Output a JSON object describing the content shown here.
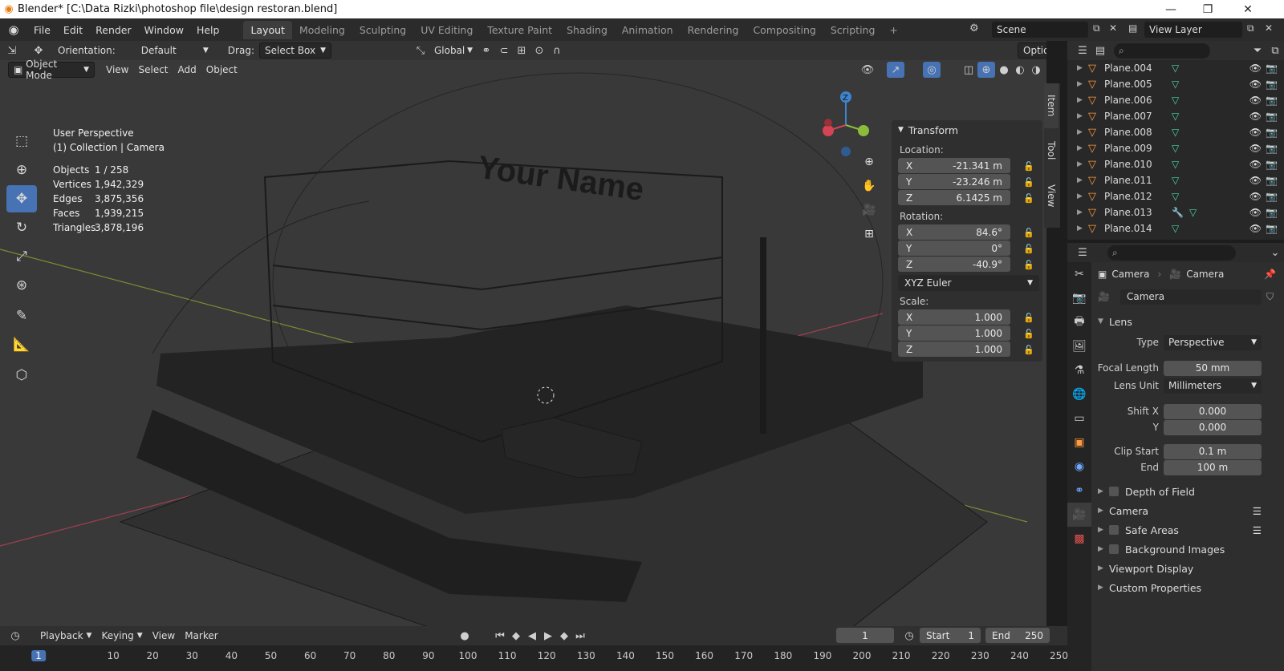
{
  "window": {
    "title": "Blender* [C:\\Data Rizki\\photoshop file\\design restoran.blend]",
    "minimize": "—",
    "maximize": "❐",
    "close": "✕"
  },
  "menu": {
    "items": [
      "File",
      "Edit",
      "Render",
      "Window",
      "Help"
    ]
  },
  "workspaces": {
    "tabs": [
      "Layout",
      "Modeling",
      "Sculpting",
      "UV Editing",
      "Texture Paint",
      "Shading",
      "Animation",
      "Rendering",
      "Compositing",
      "Scripting"
    ],
    "active": "Layout",
    "add": "+"
  },
  "scene": {
    "name": "Scene",
    "view_layer": "View Layer"
  },
  "viewport_header": {
    "orientation_label": "Orientation:",
    "orientation_value": "Default",
    "drag_label": "Drag:",
    "drag_value": "Select Box",
    "transform_orientation": "Global",
    "options": "Options",
    "mode": "Object Mode",
    "view": "View",
    "select": "Select",
    "add": "Add",
    "object": "Object"
  },
  "overlay_text": {
    "perspective": "User Perspective",
    "collection": "(1) Collection | Camera"
  },
  "stats": [
    {
      "label": "Objects",
      "value": "1 / 258"
    },
    {
      "label": "Vertices",
      "value": "1,942,329"
    },
    {
      "label": "Edges",
      "value": "3,875,356"
    },
    {
      "label": "Faces",
      "value": "1,939,215"
    },
    {
      "label": "Triangles",
      "value": "3,878,196"
    }
  ],
  "sign_text": "Your Name",
  "transform": {
    "title": "Transform",
    "location_label": "Location:",
    "location": [
      {
        "axis": "X",
        "value": "-21.341 m"
      },
      {
        "axis": "Y",
        "value": "-23.246 m"
      },
      {
        "axis": "Z",
        "value": "6.1425 m"
      }
    ],
    "rotation_label": "Rotation:",
    "rotation": [
      {
        "axis": "X",
        "value": "84.6°"
      },
      {
        "axis": "Y",
        "value": "0°"
      },
      {
        "axis": "Z",
        "value": "-40.9°"
      }
    ],
    "rotation_mode": "XYZ Euler",
    "scale_label": "Scale:",
    "scale": [
      {
        "axis": "X",
        "value": "1.000"
      },
      {
        "axis": "Y",
        "value": "1.000"
      },
      {
        "axis": "Z",
        "value": "1.000"
      }
    ]
  },
  "sidebar_tabs": [
    "Item",
    "Tool",
    "View"
  ],
  "gizmo": {
    "z": "Z"
  },
  "outliner": {
    "rows": [
      "Plane.004",
      "Plane.005",
      "Plane.006",
      "Plane.007",
      "Plane.008",
      "Plane.009",
      "Plane.010",
      "Plane.011",
      "Plane.012",
      "Plane.013",
      "Plane.014"
    ]
  },
  "properties": {
    "breadcrumb_object": "Camera",
    "breadcrumb_data": "Camera",
    "datablock": "Camera",
    "lens_panel": "Lens",
    "type_label": "Type",
    "type_value": "Perspective",
    "focal_label": "Focal Length",
    "focal_value": "50 mm",
    "lens_unit_label": "Lens Unit",
    "lens_unit_value": "Millimeters",
    "shift_x_label": "Shift X",
    "shift_x_value": "0.000",
    "shift_y_label": "Y",
    "shift_y_value": "0.000",
    "clip_start_label": "Clip Start",
    "clip_start_value": "0.1 m",
    "clip_end_label": "End",
    "clip_end_value": "100 m",
    "panels": [
      "Depth of Field",
      "Camera",
      "Safe Areas",
      "Background Images",
      "Viewport Display",
      "Custom Properties"
    ]
  },
  "timeline": {
    "playback": "Playback",
    "keying": "Keying",
    "view": "View",
    "marker": "Marker",
    "current_frame": "1",
    "start_label": "Start",
    "start_value": "1",
    "end_label": "End",
    "end_value": "250",
    "ticks": [
      "1",
      "10",
      "20",
      "30",
      "40",
      "50",
      "60",
      "70",
      "80",
      "90",
      "100",
      "110",
      "120",
      "130",
      "140",
      "150",
      "160",
      "170",
      "180",
      "190",
      "200",
      "210",
      "220",
      "230",
      "240",
      "250"
    ]
  }
}
